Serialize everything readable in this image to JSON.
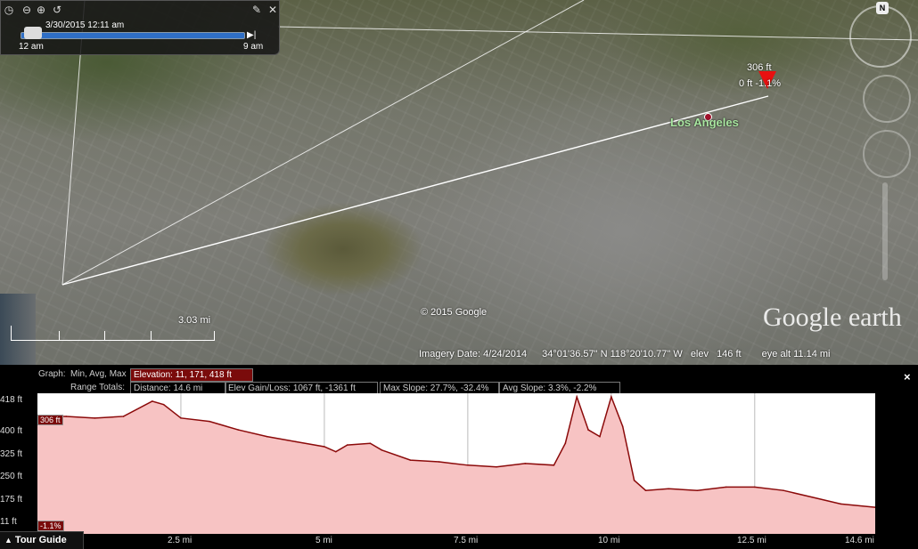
{
  "time_panel": {
    "date_time": "3/30/2015  12:11 am",
    "start_label": "12 am",
    "end_label": "9 am",
    "icons": [
      "clock-icon",
      "zoom-out-icon",
      "zoom-in-icon",
      "back-icon",
      "wrench-icon",
      "close-icon"
    ]
  },
  "compass": {
    "north_label": "N"
  },
  "map": {
    "city_label": "Los Angeles",
    "marker_elevation": "306 ft",
    "marker_info": "0 ft  -1.1%",
    "scale_label": "3.03 mi",
    "copyright": "© 2015 Google",
    "logo": "Google earth"
  },
  "status_bar": {
    "imagery_date": "Imagery Date: 4/24/2014",
    "coords": "34°01'36.57\" N  118°20'10.77\" W",
    "elev_label": "elev",
    "elev_value": "146 ft",
    "eye_alt": "eye alt  11.14 mi"
  },
  "graph_header": {
    "graph_label": "Graph:",
    "graph_modes": "Min, Avg, Max",
    "elevation": "Elevation: 11, 171, 418 ft",
    "range_totals": "Range Totals:",
    "distance": "Distance: 14.6 mi",
    "elev_gain_loss": "Elev Gain/Loss: 1067 ft, -1361 ft",
    "max_slope": "Max Slope: 27.7%, -32.4%",
    "avg_slope": "Avg Slope: 3.3%, -2.2%",
    "close": "×"
  },
  "graph": {
    "y_labels": [
      "418 ft",
      "400 ft",
      "325 ft",
      "250 ft",
      "175 ft",
      "11 ft"
    ],
    "x_labels": [
      "2.5 mi",
      "5 mi",
      "7.5 mi",
      "10 mi",
      "12.5 mi",
      "14.6 mi"
    ],
    "current_badge": "306 ft",
    "slope_badge": "-1.1%",
    "fill_color": "#f7c3c3",
    "line_color": "#8b0a0a"
  },
  "chart_data": {
    "type": "area",
    "x": [
      0,
      0.5,
      1,
      1.5,
      2,
      2.2,
      2.5,
      3,
      3.5,
      4,
      4.5,
      5,
      5.2,
      5.4,
      5.8,
      6,
      6.5,
      7,
      7.5,
      8,
      8.5,
      9,
      9.2,
      9.4,
      9.6,
      9.8,
      10,
      10.2,
      10.4,
      10.6,
      11,
      11.5,
      12,
      12.5,
      13,
      13.5,
      14,
      14.6
    ],
    "y": [
      360,
      360,
      355,
      360,
      405,
      395,
      355,
      345,
      320,
      300,
      285,
      270,
      255,
      275,
      280,
      260,
      230,
      225,
      215,
      210,
      220,
      215,
      280,
      418,
      320,
      300,
      418,
      330,
      170,
      140,
      145,
      140,
      150,
      150,
      140,
      120,
      100,
      90
    ],
    "xlabel": "",
    "ylabel": "",
    "x_ticks": [
      "2.5 mi",
      "5 mi",
      "7.5 mi",
      "10 mi",
      "12.5 mi",
      "14.6 mi"
    ],
    "xlim": [
      0,
      14.6
    ],
    "ylim": [
      11,
      418
    ],
    "grid": true
  }
}
